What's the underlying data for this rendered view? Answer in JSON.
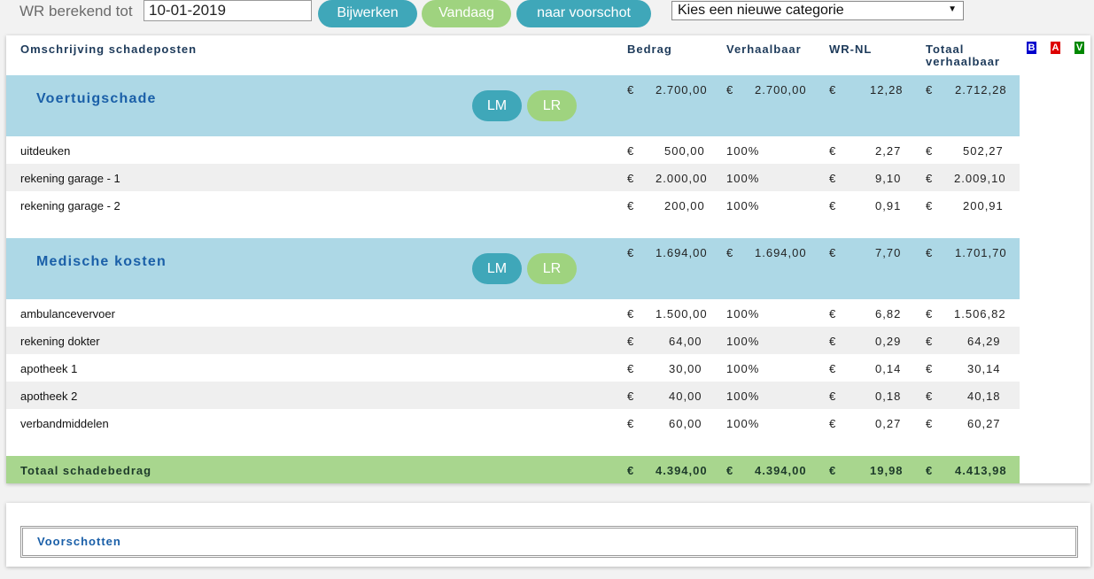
{
  "toolbar": {
    "wr_label": "WR berekend tot",
    "date_value": "10-01-2019",
    "update_label": "Bijwerken",
    "today_label": "Vandaag",
    "advance_label": "naar voorschot",
    "category_select": "Kies een nieuwe categorie"
  },
  "table": {
    "headers": {
      "description": "Omschrijving schadeposten",
      "amount": "Bedrag",
      "recoverable": "Verhaalbaar",
      "wr_nl": "WR-NL",
      "total_line1": "Totaal",
      "total_line2": "verhaalbaar"
    },
    "flags": [
      "B",
      "A",
      "V"
    ],
    "flag_colors": {
      "B": "#0000cc",
      "A": "#dd0000",
      "V": "#008800"
    },
    "currency": "€",
    "categories": [
      {
        "title": "Voertuigschade",
        "lm": "LM",
        "lr": "LR",
        "amount": "2.700,00",
        "recoverable": "2.700,00",
        "wr_nl": "12,28",
        "total": "2.712,28",
        "items": [
          {
            "desc": "uitdeuken",
            "amount": "500,00",
            "pct": "100%",
            "wr_nl": "2,27",
            "total": "502,27"
          },
          {
            "desc": "rekening garage - 1",
            "amount": "2.000,00",
            "pct": "100%",
            "wr_nl": "9,10",
            "total": "2.009,10"
          },
          {
            "desc": "rekening garage - 2",
            "amount": "200,00",
            "pct": "100%",
            "wr_nl": "0,91",
            "total": "200,91"
          }
        ]
      },
      {
        "title": "Medische kosten",
        "lm": "LM",
        "lr": "LR",
        "amount": "1.694,00",
        "recoverable": "1.694,00",
        "wr_nl": "7,70",
        "total": "1.701,70",
        "items": [
          {
            "desc": "ambulancevervoer",
            "amount": "1.500,00",
            "pct": "100%",
            "wr_nl": "6,82",
            "total": "1.506,82"
          },
          {
            "desc": "rekening dokter",
            "amount": "64,00",
            "pct": "100%",
            "wr_nl": "0,29",
            "total": "64,29"
          },
          {
            "desc": "apotheek 1",
            "amount": "30,00",
            "pct": "100%",
            "wr_nl": "0,14",
            "total": "30,14"
          },
          {
            "desc": "apotheek 2",
            "amount": "40,00",
            "pct": "100%",
            "wr_nl": "0,18",
            "total": "40,18"
          },
          {
            "desc": "verbandmiddelen",
            "amount": "60,00",
            "pct": "100%",
            "wr_nl": "0,27",
            "total": "60,27"
          }
        ]
      }
    ],
    "total_row": {
      "label": "Totaal schadebedrag",
      "amount": "4.394,00",
      "recoverable": "4.394,00",
      "wr_nl": "19,98",
      "total": "4.413,98"
    }
  },
  "advances": {
    "title": "Voorschotten"
  },
  "colors": {
    "accent_blue": "#3fa7b9",
    "accent_green": "#9fd37f",
    "category_bg": "#add8e6",
    "total_bg": "#a8d68e"
  }
}
